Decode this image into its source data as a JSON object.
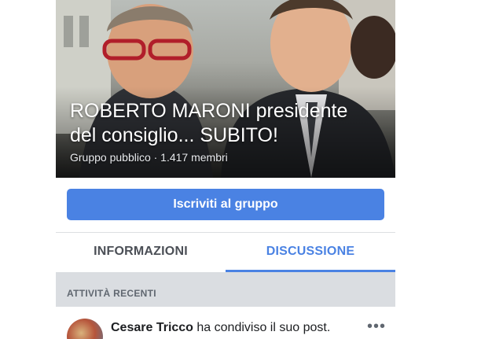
{
  "group": {
    "title_line1": "ROBERTO MARONI presidente",
    "title_line2": "del consiglio... SUBITO!",
    "meta": "Gruppo pubblico · 1.417 membri",
    "join_label": "Iscriviti al gruppo"
  },
  "tabs": [
    {
      "label": "INFORMAZIONI",
      "active": false
    },
    {
      "label": "DISCUSSIONE",
      "active": true
    }
  ],
  "section": {
    "label": "ATTIVITÀ RECENTI"
  },
  "post": {
    "author": "Cesare Tricco",
    "action": " ha condiviso il suo post.",
    "more_icon": "more-horizontal-icon"
  },
  "colors": {
    "accent": "#4a82e3",
    "band": "#dadde1",
    "text": "#1c1e21"
  }
}
